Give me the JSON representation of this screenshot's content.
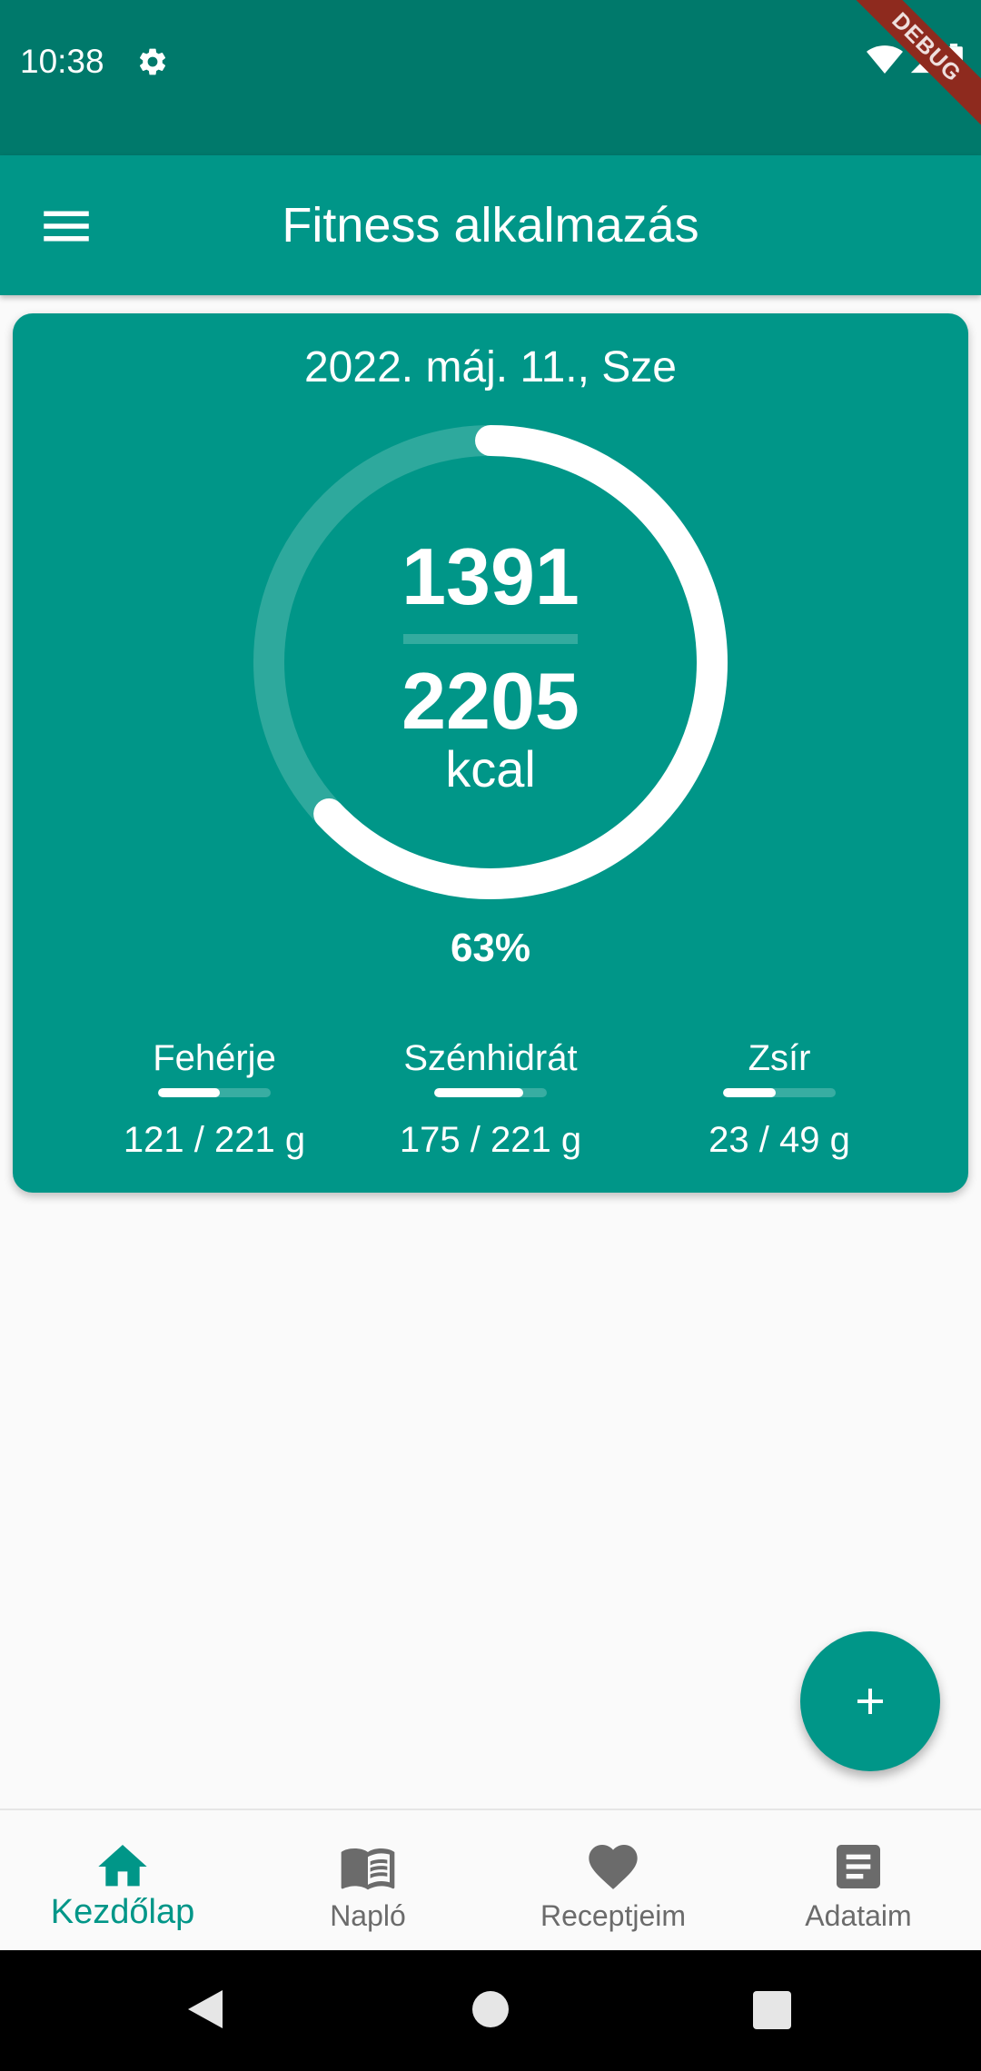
{
  "status_bar": {
    "time": "10:38",
    "debug_label": "DEBUG"
  },
  "app_bar": {
    "title": "Fitness alkalmazás"
  },
  "summary": {
    "date": "2022. máj. 11., Sze",
    "consumed": "1391",
    "goal": "2205",
    "unit": "kcal",
    "percent_text": "63%",
    "progress": 0.63
  },
  "macros": [
    {
      "name": "Fehérje",
      "value_text": "121 / 221 g",
      "progress": 0.55
    },
    {
      "name": "Szénhidrát",
      "value_text": "175 / 221 g",
      "progress": 0.79
    },
    {
      "name": "Zsír",
      "value_text": "23 / 49 g",
      "progress": 0.47
    }
  ],
  "fab": {
    "icon": "plus-icon"
  },
  "bottom_nav": {
    "items": [
      {
        "label": "Kezdőlap",
        "icon": "home-icon",
        "active": true
      },
      {
        "label": "Napló",
        "icon": "book-icon",
        "active": false
      },
      {
        "label": "Receptjeim",
        "icon": "heart-icon",
        "active": false
      },
      {
        "label": "Adataim",
        "icon": "document-icon",
        "active": false
      }
    ]
  },
  "colors": {
    "primary": "#009688",
    "primary_dark": "#00796b",
    "inactive": "#6b6b6b",
    "background": "#fafafa"
  }
}
